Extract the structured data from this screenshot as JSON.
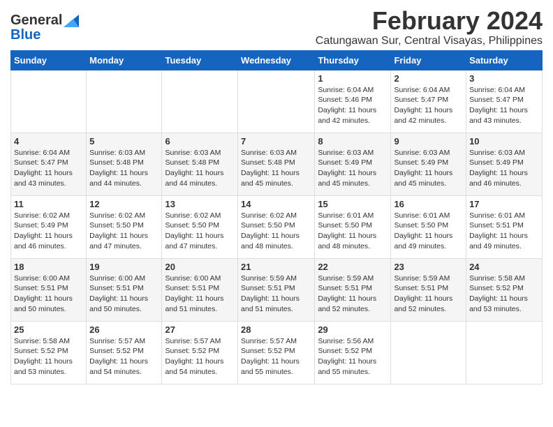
{
  "logo": {
    "general": "General",
    "blue": "Blue"
  },
  "title": {
    "month_year": "February 2024",
    "location": "Catungawan Sur, Central Visayas, Philippines"
  },
  "headers": [
    "Sunday",
    "Monday",
    "Tuesday",
    "Wednesday",
    "Thursday",
    "Friday",
    "Saturday"
  ],
  "weeks": [
    [
      {
        "day": "",
        "info": ""
      },
      {
        "day": "",
        "info": ""
      },
      {
        "day": "",
        "info": ""
      },
      {
        "day": "",
        "info": ""
      },
      {
        "day": "1",
        "sunrise": "6:04 AM",
        "sunset": "5:46 PM",
        "daylight": "11 hours and 42 minutes."
      },
      {
        "day": "2",
        "sunrise": "6:04 AM",
        "sunset": "5:47 PM",
        "daylight": "11 hours and 42 minutes."
      },
      {
        "day": "3",
        "sunrise": "6:04 AM",
        "sunset": "5:47 PM",
        "daylight": "11 hours and 43 minutes."
      }
    ],
    [
      {
        "day": "4",
        "sunrise": "6:04 AM",
        "sunset": "5:47 PM",
        "daylight": "11 hours and 43 minutes."
      },
      {
        "day": "5",
        "sunrise": "6:03 AM",
        "sunset": "5:48 PM",
        "daylight": "11 hours and 44 minutes."
      },
      {
        "day": "6",
        "sunrise": "6:03 AM",
        "sunset": "5:48 PM",
        "daylight": "11 hours and 44 minutes."
      },
      {
        "day": "7",
        "sunrise": "6:03 AM",
        "sunset": "5:48 PM",
        "daylight": "11 hours and 45 minutes."
      },
      {
        "day": "8",
        "sunrise": "6:03 AM",
        "sunset": "5:49 PM",
        "daylight": "11 hours and 45 minutes."
      },
      {
        "day": "9",
        "sunrise": "6:03 AM",
        "sunset": "5:49 PM",
        "daylight": "11 hours and 45 minutes."
      },
      {
        "day": "10",
        "sunrise": "6:03 AM",
        "sunset": "5:49 PM",
        "daylight": "11 hours and 46 minutes."
      }
    ],
    [
      {
        "day": "11",
        "sunrise": "6:02 AM",
        "sunset": "5:49 PM",
        "daylight": "11 hours and 46 minutes."
      },
      {
        "day": "12",
        "sunrise": "6:02 AM",
        "sunset": "5:50 PM",
        "daylight": "11 hours and 47 minutes."
      },
      {
        "day": "13",
        "sunrise": "6:02 AM",
        "sunset": "5:50 PM",
        "daylight": "11 hours and 47 minutes."
      },
      {
        "day": "14",
        "sunrise": "6:02 AM",
        "sunset": "5:50 PM",
        "daylight": "11 hours and 48 minutes."
      },
      {
        "day": "15",
        "sunrise": "6:01 AM",
        "sunset": "5:50 PM",
        "daylight": "11 hours and 48 minutes."
      },
      {
        "day": "16",
        "sunrise": "6:01 AM",
        "sunset": "5:50 PM",
        "daylight": "11 hours and 49 minutes."
      },
      {
        "day": "17",
        "sunrise": "6:01 AM",
        "sunset": "5:51 PM",
        "daylight": "11 hours and 49 minutes."
      }
    ],
    [
      {
        "day": "18",
        "sunrise": "6:00 AM",
        "sunset": "5:51 PM",
        "daylight": "11 hours and 50 minutes."
      },
      {
        "day": "19",
        "sunrise": "6:00 AM",
        "sunset": "5:51 PM",
        "daylight": "11 hours and 50 minutes."
      },
      {
        "day": "20",
        "sunrise": "6:00 AM",
        "sunset": "5:51 PM",
        "daylight": "11 hours and 51 minutes."
      },
      {
        "day": "21",
        "sunrise": "5:59 AM",
        "sunset": "5:51 PM",
        "daylight": "11 hours and 51 minutes."
      },
      {
        "day": "22",
        "sunrise": "5:59 AM",
        "sunset": "5:51 PM",
        "daylight": "11 hours and 52 minutes."
      },
      {
        "day": "23",
        "sunrise": "5:59 AM",
        "sunset": "5:51 PM",
        "daylight": "11 hours and 52 minutes."
      },
      {
        "day": "24",
        "sunrise": "5:58 AM",
        "sunset": "5:52 PM",
        "daylight": "11 hours and 53 minutes."
      }
    ],
    [
      {
        "day": "25",
        "sunrise": "5:58 AM",
        "sunset": "5:52 PM",
        "daylight": "11 hours and 53 minutes."
      },
      {
        "day": "26",
        "sunrise": "5:57 AM",
        "sunset": "5:52 PM",
        "daylight": "11 hours and 54 minutes."
      },
      {
        "day": "27",
        "sunrise": "5:57 AM",
        "sunset": "5:52 PM",
        "daylight": "11 hours and 54 minutes."
      },
      {
        "day": "28",
        "sunrise": "5:57 AM",
        "sunset": "5:52 PM",
        "daylight": "11 hours and 55 minutes."
      },
      {
        "day": "29",
        "sunrise": "5:56 AM",
        "sunset": "5:52 PM",
        "daylight": "11 hours and 55 minutes."
      },
      {
        "day": "",
        "info": ""
      },
      {
        "day": "",
        "info": ""
      }
    ]
  ]
}
